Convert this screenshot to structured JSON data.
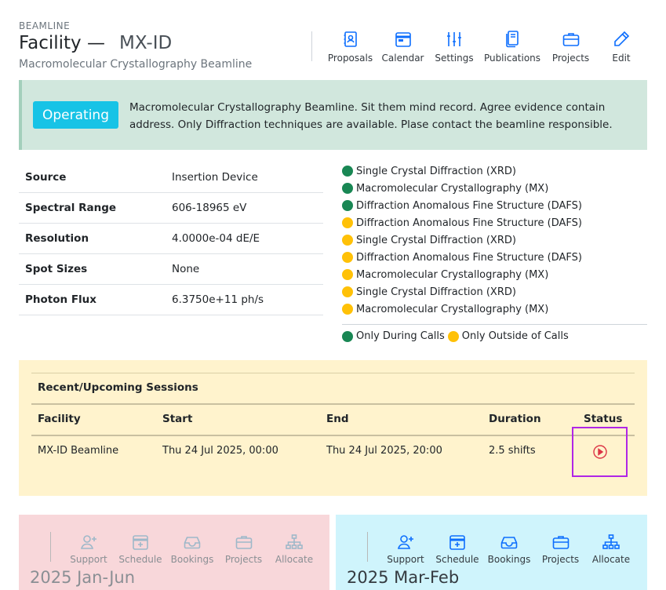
{
  "header": {
    "eyebrow": "BEAMLINE",
    "title_prefix": "Facility —",
    "title_code": "MX-ID",
    "subtitle": "Macromolecular Crystallography Beamline"
  },
  "toolbar": [
    {
      "label": "Proposals",
      "icon": "proposals-icon"
    },
    {
      "label": "Calendar",
      "icon": "calendar-icon"
    },
    {
      "label": "Settings",
      "icon": "settings-sliders-icon"
    },
    {
      "label": "Publications",
      "icon": "publications-icon"
    },
    {
      "label": "Projects",
      "icon": "briefcase-icon"
    },
    {
      "label": "Edit",
      "icon": "pencil-icon"
    }
  ],
  "status": {
    "badge": "Operating",
    "message": "Macromolecular Crystallography Beamline. Sit them mind record. Agree evidence contain address. Only Diffraction techniques are available. Plase contact the beamline responsible."
  },
  "specs": [
    {
      "key": "Source",
      "value": "Insertion Device"
    },
    {
      "key": "Spectral Range",
      "value": "606-18965 eV"
    },
    {
      "key": "Resolution",
      "value": "4.0000e-04 dE/E"
    },
    {
      "key": "Spot Sizes",
      "value": "None"
    },
    {
      "key": "Photon Flux",
      "value": "6.3750e+11 ph/s"
    }
  ],
  "techniques": [
    {
      "name": "Single Crystal Diffraction (XRD)",
      "availability": "during"
    },
    {
      "name": "Macromolecular Crystallography (MX)",
      "availability": "during"
    },
    {
      "name": "Diffraction Anomalous Fine Structure (DAFS)",
      "availability": "during"
    },
    {
      "name": "Diffraction Anomalous Fine Structure (DAFS)",
      "availability": "outside"
    },
    {
      "name": "Single Crystal Diffraction (XRD)",
      "availability": "outside"
    },
    {
      "name": "Diffraction Anomalous Fine Structure (DAFS)",
      "availability": "outside"
    },
    {
      "name": "Macromolecular Crystallography (MX)",
      "availability": "outside"
    },
    {
      "name": "Single Crystal Diffraction (XRD)",
      "availability": "outside"
    },
    {
      "name": "Macromolecular Crystallography (MX)",
      "availability": "outside"
    }
  ],
  "legend": {
    "during": "Only During Calls",
    "outside": "Only Outside of Calls"
  },
  "colors": {
    "during": "#198754",
    "outside": "#ffc107",
    "badge": "#17c3e6",
    "status_icon": "#dc3545"
  },
  "sessions": {
    "title": "Recent/Upcoming Sessions",
    "columns": [
      "Facility",
      "Start",
      "End",
      "Duration",
      "Status"
    ],
    "rows": [
      {
        "facility": "MX-ID Beamline",
        "start": "Thu 24 Jul 2025, 00:00",
        "end": "Thu 24 Jul 2025, 20:00",
        "duration": "2.5 shifts",
        "status_icon": "play-circle-icon"
      }
    ]
  },
  "cards": [
    {
      "period": "2025 Jan-Jun",
      "tools": [
        "Support",
        "Schedule",
        "Bookings",
        "Projects",
        "Allocate"
      ]
    },
    {
      "period": "2025 Mar-Feb",
      "tools": [
        "Support",
        "Schedule",
        "Bookings",
        "Projects",
        "Allocate"
      ]
    }
  ]
}
